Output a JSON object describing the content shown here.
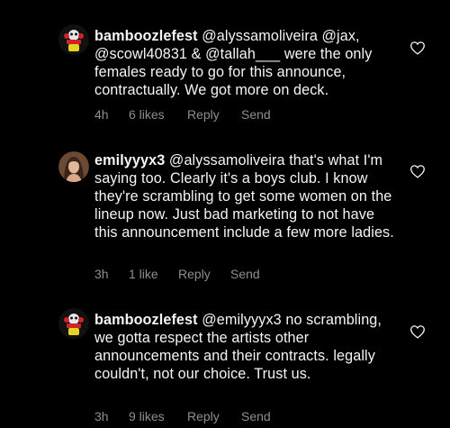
{
  "comments": [
    {
      "username": "bamboozlefest",
      "text": "@alyssamoliveira @jax, @scowl40831 & @tallah___ were the only females ready to go for this announce, contractually. We got more on deck.",
      "time": "4h",
      "likes": "6 likes",
      "reply": "Reply",
      "send": "Send",
      "avatar_icon": "bamboozle-logo-avatar"
    },
    {
      "username": "emilyyyx3",
      "text": "@alyssamoliveira that's what I'm saying too. Clearly it's a boys club. I know they're scrambling to get some women on the lineup now. Just bad marketing to not have this announcement include a few more ladies.",
      "time": "3h",
      "likes": "1 like",
      "reply": "Reply",
      "send": "Send",
      "avatar_icon": "user-photo-avatar"
    },
    {
      "username": "bamboozlefest",
      "text": "@emilyyyx3 no scrambling, we gotta respect the artists other announcements and their contracts. legally couldn't, not our choice. Trust us.",
      "time": "3h",
      "likes": "9 likes",
      "reply": "Reply",
      "send": "Send",
      "avatar_icon": "bamboozle-logo-avatar"
    }
  ],
  "colors": {
    "background": "#000000",
    "text": "#f5f5f5",
    "meta": "#8e8e8e"
  },
  "icons": {
    "like": "heart-outline-icon"
  }
}
